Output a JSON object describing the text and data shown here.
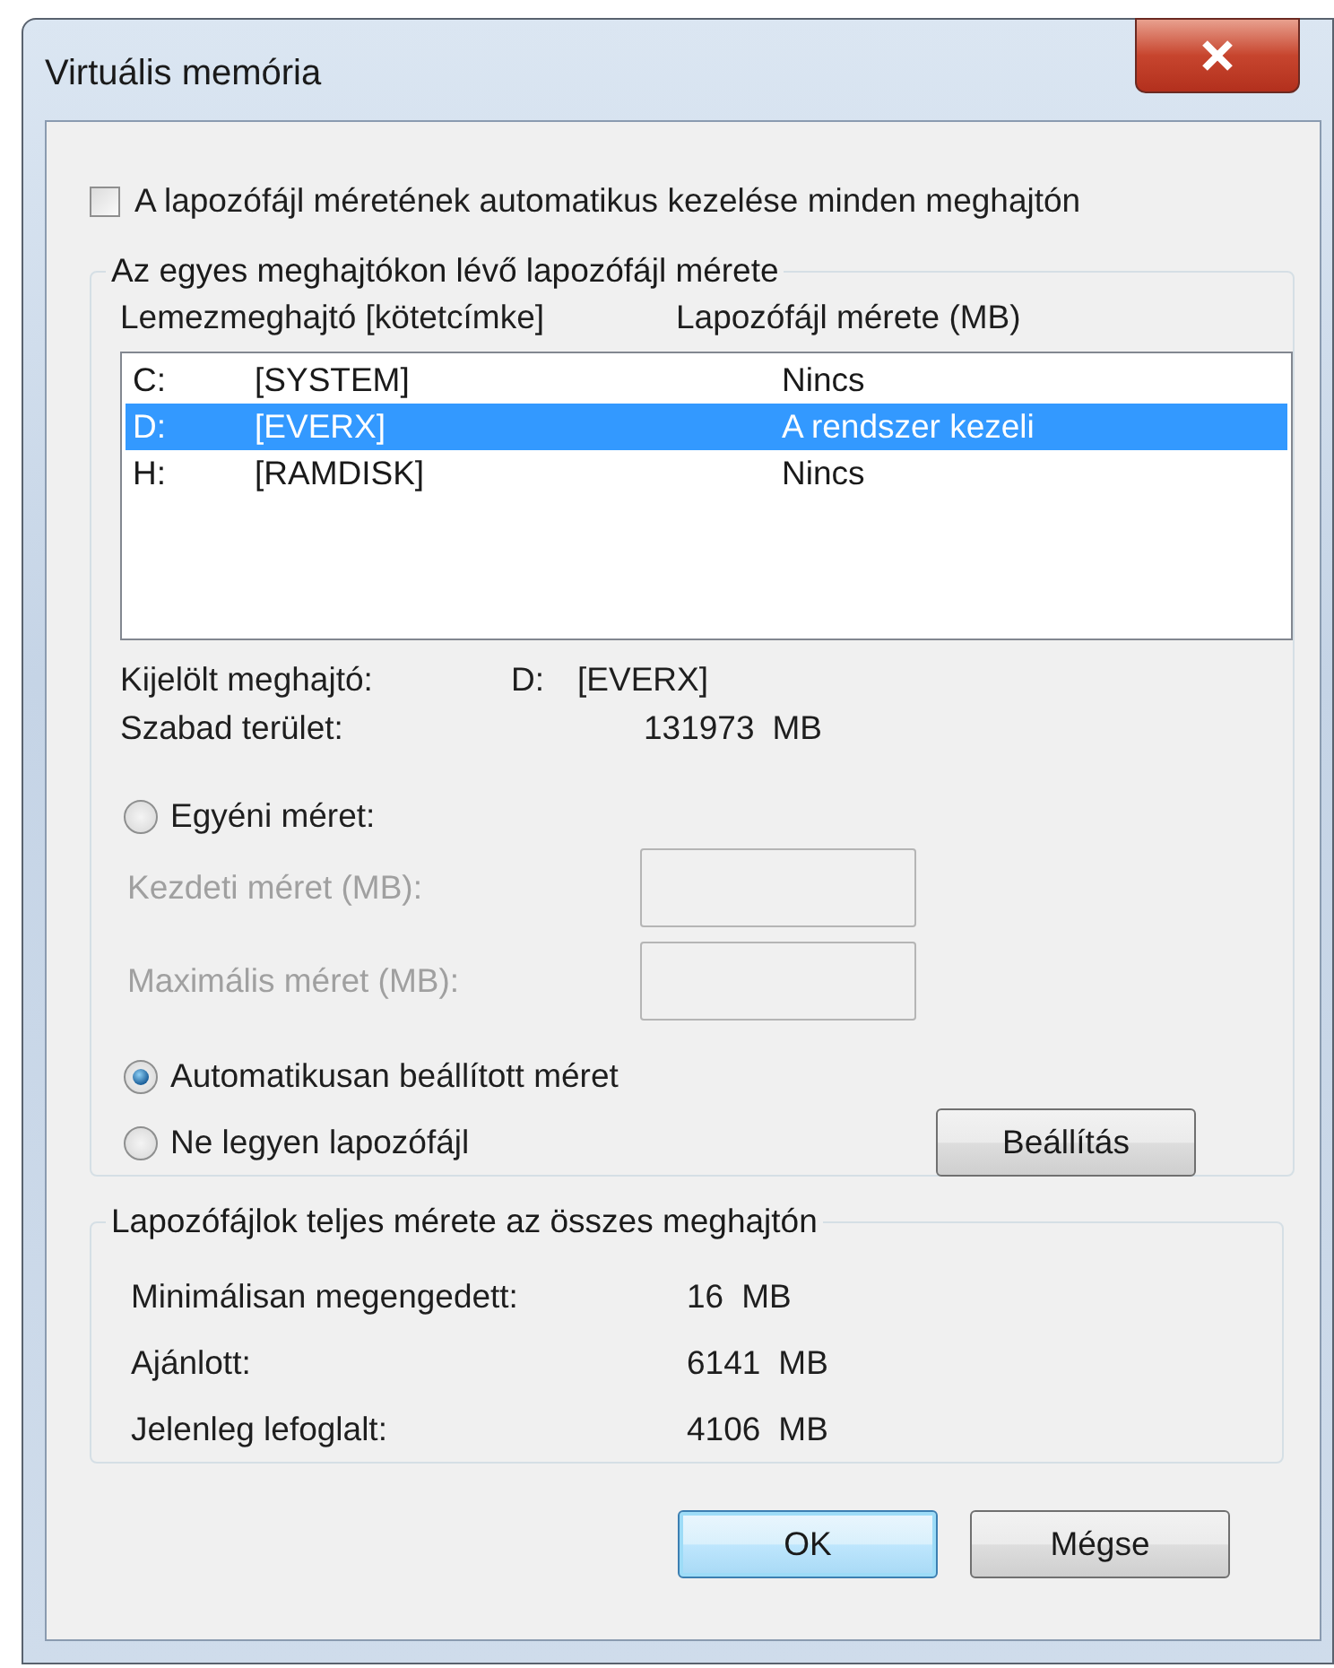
{
  "window": {
    "title": "Virtuális memória"
  },
  "auto_manage": {
    "label": "A lapozófájl méretének automatikus kezelése minden meghajtón",
    "checked": false
  },
  "drives_group": {
    "title": "Az egyes meghajtókon lévő lapozófájl mérete",
    "columns": [
      "Lemezmeghajtó [kötetcímke]",
      "Lapozófájl mérete (MB)"
    ],
    "drives": [
      {
        "letter": "C:",
        "volume": "[SYSTEM]",
        "size": "Nincs",
        "selected": false
      },
      {
        "letter": "D:",
        "volume": "[EVERX]",
        "size": "A rendszer kezeli",
        "selected": true
      },
      {
        "letter": "H:",
        "volume": "[RAMDISK]",
        "size": "Nincs",
        "selected": false
      }
    ],
    "selected_drive": {
      "label": "Kijelölt meghajtó:",
      "letter": "D:",
      "volume": "[EVERX]"
    },
    "free_space": {
      "label": "Szabad terület:",
      "value": "131973",
      "unit": "MB"
    },
    "options": [
      {
        "label": "Egyéni méret:",
        "selected": false
      },
      {
        "label": "Automatikusan beállított méret",
        "selected": true
      },
      {
        "label": "Ne legyen lapozófájl",
        "selected": false
      }
    ],
    "fields": [
      {
        "label": "Kezdeti méret (MB):",
        "disabled": true
      },
      {
        "label": "Maximális méret (MB):",
        "disabled": true
      }
    ],
    "set_button": "Beállítás"
  },
  "totals_group": {
    "title": "Lapozófájlok teljes mérete az összes meghajtón",
    "rows": [
      {
        "label": "Minimálisan megengedett:",
        "value": "16",
        "unit": "MB"
      },
      {
        "label": "Ajánlott:",
        "value": "6141",
        "unit": "MB"
      },
      {
        "label": "Jelenleg lefoglalt:",
        "value": "4106",
        "unit": "MB"
      }
    ]
  },
  "buttons": [
    {
      "label": "OK",
      "default": true
    },
    {
      "label": "Mégse",
      "default": false
    }
  ]
}
